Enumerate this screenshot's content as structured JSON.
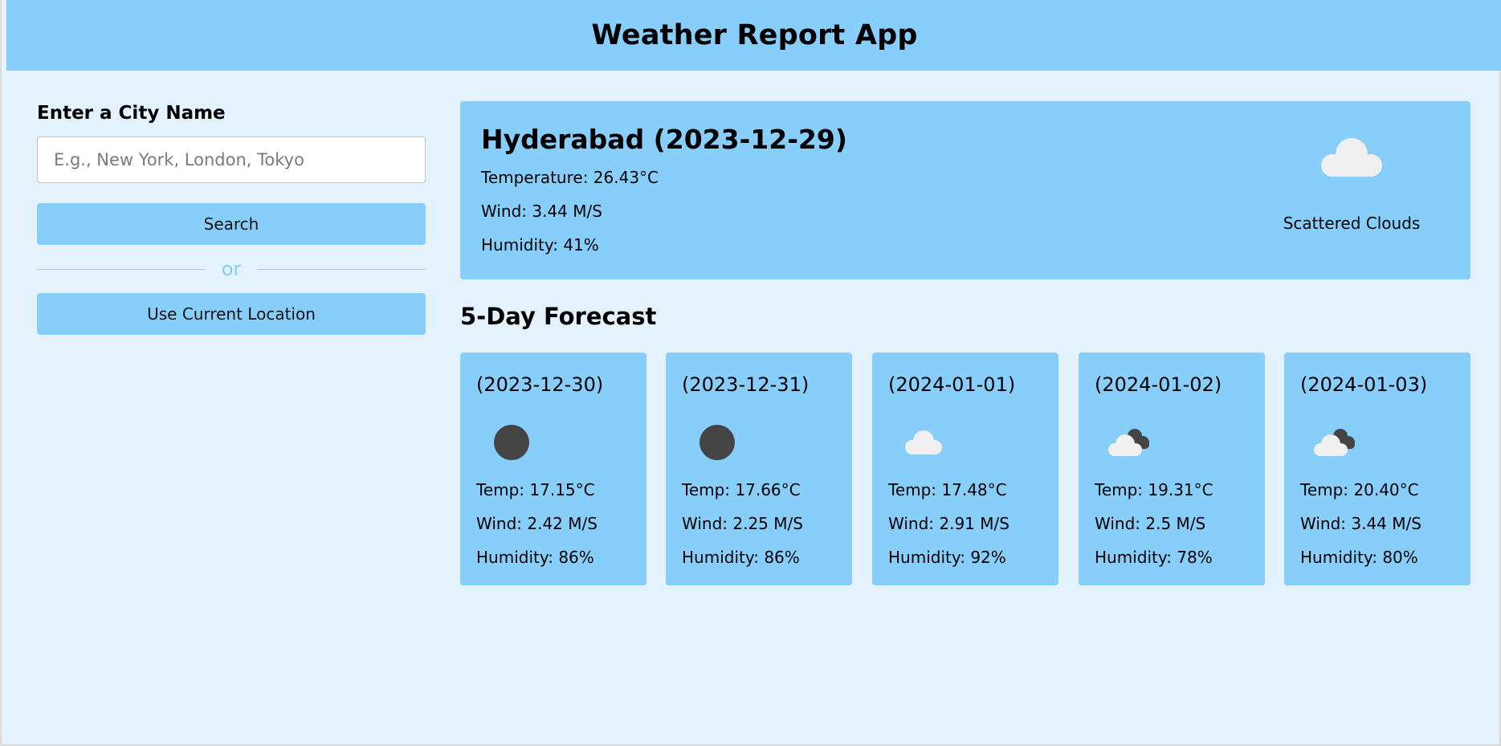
{
  "app": {
    "title": "Weather Report App"
  },
  "search": {
    "label": "Enter a City Name",
    "placeholder": "E.g., New York, London, Tokyo",
    "value": "",
    "search_button": "Search",
    "divider_text": "or",
    "location_button": "Use Current Location"
  },
  "current": {
    "heading": "Hyderabad (2023-12-29)",
    "temperature": "Temperature: 26.43°C",
    "wind": "Wind: 3.44 M/S",
    "humidity": "Humidity: 41%",
    "icon": "scattered-clouds-icon",
    "description": "Scattered Clouds"
  },
  "forecast": {
    "title": "5-Day Forecast",
    "days": [
      {
        "date": "(2023-12-30)",
        "icon": "moon-icon",
        "temp": "Temp: 17.15°C",
        "wind": "Wind: 2.42 M/S",
        "humidity": "Humidity: 86%"
      },
      {
        "date": "(2023-12-31)",
        "icon": "moon-icon",
        "temp": "Temp: 17.66°C",
        "wind": "Wind: 2.25 M/S",
        "humidity": "Humidity: 86%"
      },
      {
        "date": "(2024-01-01)",
        "icon": "cloud-icon",
        "temp": "Temp: 17.48°C",
        "wind": "Wind: 2.91 M/S",
        "humidity": "Humidity: 92%"
      },
      {
        "date": "(2024-01-02)",
        "icon": "broken-clouds-icon",
        "temp": "Temp: 19.31°C",
        "wind": "Wind: 2.5 M/S",
        "humidity": "Humidity: 78%"
      },
      {
        "date": "(2024-01-03)",
        "icon": "broken-clouds-icon",
        "temp": "Temp: 20.40°C",
        "wind": "Wind: 3.44 M/S",
        "humidity": "Humidity: 80%"
      }
    ]
  },
  "colors": {
    "header_bg": "#87cefa",
    "page_bg": "#e3f2fd",
    "card_bg": "#87cefa",
    "cloud_light": "#f0f0f0",
    "cloud_dark": "#444444"
  }
}
